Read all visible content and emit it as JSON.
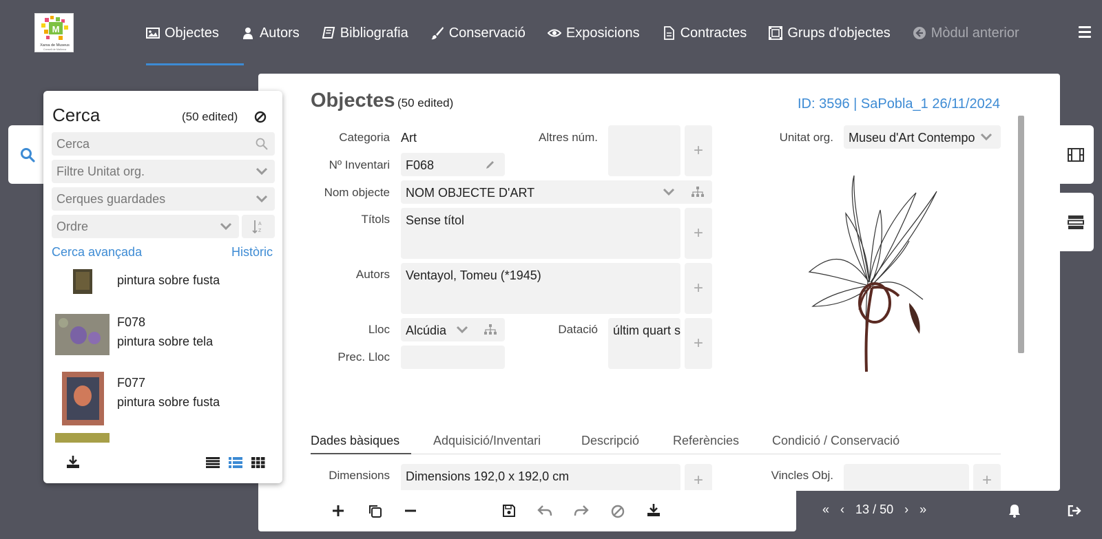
{
  "nav": {
    "items": [
      {
        "label": "Objectes",
        "icon": "image-icon"
      },
      {
        "label": "Autors",
        "icon": "user-icon"
      },
      {
        "label": "Bibliografia",
        "icon": "book-icon"
      },
      {
        "label": "Conservació",
        "icon": "brush-icon"
      },
      {
        "label": "Exposicions",
        "icon": "eye-icon"
      },
      {
        "label": "Contractes",
        "icon": "document-icon"
      },
      {
        "label": "Grups d'objectes",
        "icon": "group-icon"
      },
      {
        "label": "Mòdul anterior",
        "icon": "back-arrow-icon"
      }
    ],
    "active": "Objectes"
  },
  "logo": {
    "caption": "Xarxa de Museus",
    "subcaption": "Consell de Mallorca"
  },
  "search": {
    "title": "Cerca",
    "edited": "(50 edited)",
    "search_placeholder": "Cerca",
    "filter_placeholder": "Filtre Unitat org.",
    "saved_placeholder": "Cerques guardades",
    "order_placeholder": "Ordre",
    "advanced_link": "Cerca avançada",
    "history_link": "Històric",
    "results": [
      {
        "code": "",
        "desc": "pintura sobre fusta"
      },
      {
        "code": "F078",
        "desc": "pintura sobre tela"
      },
      {
        "code": "F077",
        "desc": "pintura sobre fusta"
      }
    ]
  },
  "record": {
    "title": "Objectes",
    "edited": "(50 edited)",
    "id_line": "ID: 3596 | SaPobla_1 26/11/2024",
    "labels": {
      "categoria": "Categoria",
      "inventari": "Nº Inventari",
      "nom": "Nom objecte",
      "titols": "Títols",
      "autors": "Autors",
      "lloc": "Lloc",
      "prec_lloc": "Prec. Lloc",
      "altres": "Altres núm.",
      "datacio": "Datació",
      "unitat": "Unitat org.",
      "dimensions": "Dimensions",
      "vincles": "Vincles Obj."
    },
    "values": {
      "categoria": "Art",
      "inventari": "F068",
      "nom": "NOM OBJECTE D'ART",
      "titols": "Sense títol",
      "autors": "Ventayol, Tomeu (*1945)",
      "lloc": "Alcúdia",
      "datacio": "últim quart s",
      "unitat": "Museu d'Art Contempo",
      "dimensions": "Dimensions 192,0 x 192,0 cm"
    }
  },
  "tabs": [
    "Dades bàsiques",
    "Adquisició/Inventari",
    "Descripció",
    "Referències",
    "Condició / Conservació"
  ],
  "pager": {
    "current": "13",
    "total": "50",
    "separator": "/"
  },
  "colors": {
    "accent": "#3d8bd4",
    "background": "#53545e"
  }
}
